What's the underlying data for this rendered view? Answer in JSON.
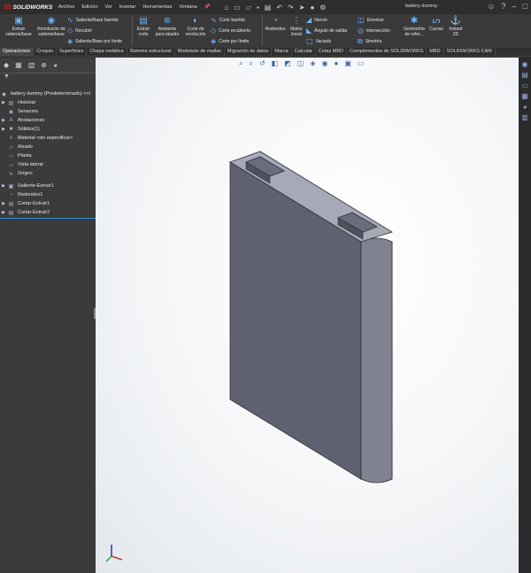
{
  "app": {
    "logo_mark": "3S",
    "logo_name": "SOLIDWORKS"
  },
  "menu": [
    "Archivo",
    "Edición",
    "Ver",
    "Insertar",
    "Herramientas",
    "Ventana"
  ],
  "document_title": "battery dummy",
  "commands": {
    "extrude_boss": "Extruir saliente/base",
    "revolve_boss": "Revolución de saliente/base",
    "swept_boss": "Saliente/Base barrido",
    "recubrir": "Recubrir",
    "boundary_boss": "Saliente/Base por límite",
    "extrude_cut": "Extruir corte",
    "hole_wizard": "Asistente para taladro",
    "revolve_cut": "Corte de revolución",
    "swept_cut": "Corte barrido",
    "lofted_cut": "Corte recubierto",
    "boundary_cut": "Corte por límite",
    "fillet": "Redondeo",
    "linear_pattern": "Matriz lineal",
    "rib": "Nervio",
    "draft": "Ángulo de salida",
    "shell": "Vaciado",
    "wrap": "Envolver",
    "intersect": "Intersección",
    "mirror": "Simetría",
    "ref_geometry": "Geometría de refer...",
    "curves": "Curvas",
    "instant3d": "Instant 3D"
  },
  "tabs": [
    "Operaciones",
    "Croquis",
    "Superficies",
    "Chapa metálica",
    "Sistema estructural",
    "Modelado de mallas",
    "Migración de datos",
    "Marca",
    "Calcular",
    "Cotas MBD",
    "Complementos de SOLIDWORKS",
    "MBD",
    "SOLIDWORKS CAM"
  ],
  "tree": {
    "root": "battery dummy (Predeterminado) <<I",
    "items": [
      {
        "label": "Historial",
        "expandable": true,
        "icon": "history-icon"
      },
      {
        "label": "Sensores",
        "expandable": false,
        "icon": "sensor-icon"
      },
      {
        "label": "Anotaciones",
        "expandable": true,
        "icon": "annotation-icon"
      },
      {
        "label": "Sólidos(1)",
        "expandable": true,
        "icon": "solid-bodies-icon"
      },
      {
        "label": "Material <sin especificar>",
        "expandable": false,
        "icon": "material-icon"
      },
      {
        "label": "Alzado",
        "expandable": false,
        "icon": "plane-icon"
      },
      {
        "label": "Planta",
        "expandable": false,
        "icon": "plane-icon"
      },
      {
        "label": "Vista lateral",
        "expandable": false,
        "icon": "plane-icon"
      },
      {
        "label": "Origen",
        "expandable": false,
        "icon": "origin-icon"
      },
      {
        "label": "Saliente-Extruir1",
        "expandable": true,
        "icon": "extrude-icon"
      },
      {
        "label": "Redondeo1",
        "expandable": false,
        "icon": "fillet-icon"
      },
      {
        "label": "Cortar-Extruir1",
        "expandable": true,
        "icon": "cut-icon"
      },
      {
        "label": "Cortar-Extruir2",
        "expandable": true,
        "icon": "cut-icon"
      }
    ]
  },
  "colors": {
    "accent": "#3b8de0",
    "model_front": "#5f6170",
    "model_side": "#7d7f8d",
    "model_top": "#a7a9b8"
  }
}
